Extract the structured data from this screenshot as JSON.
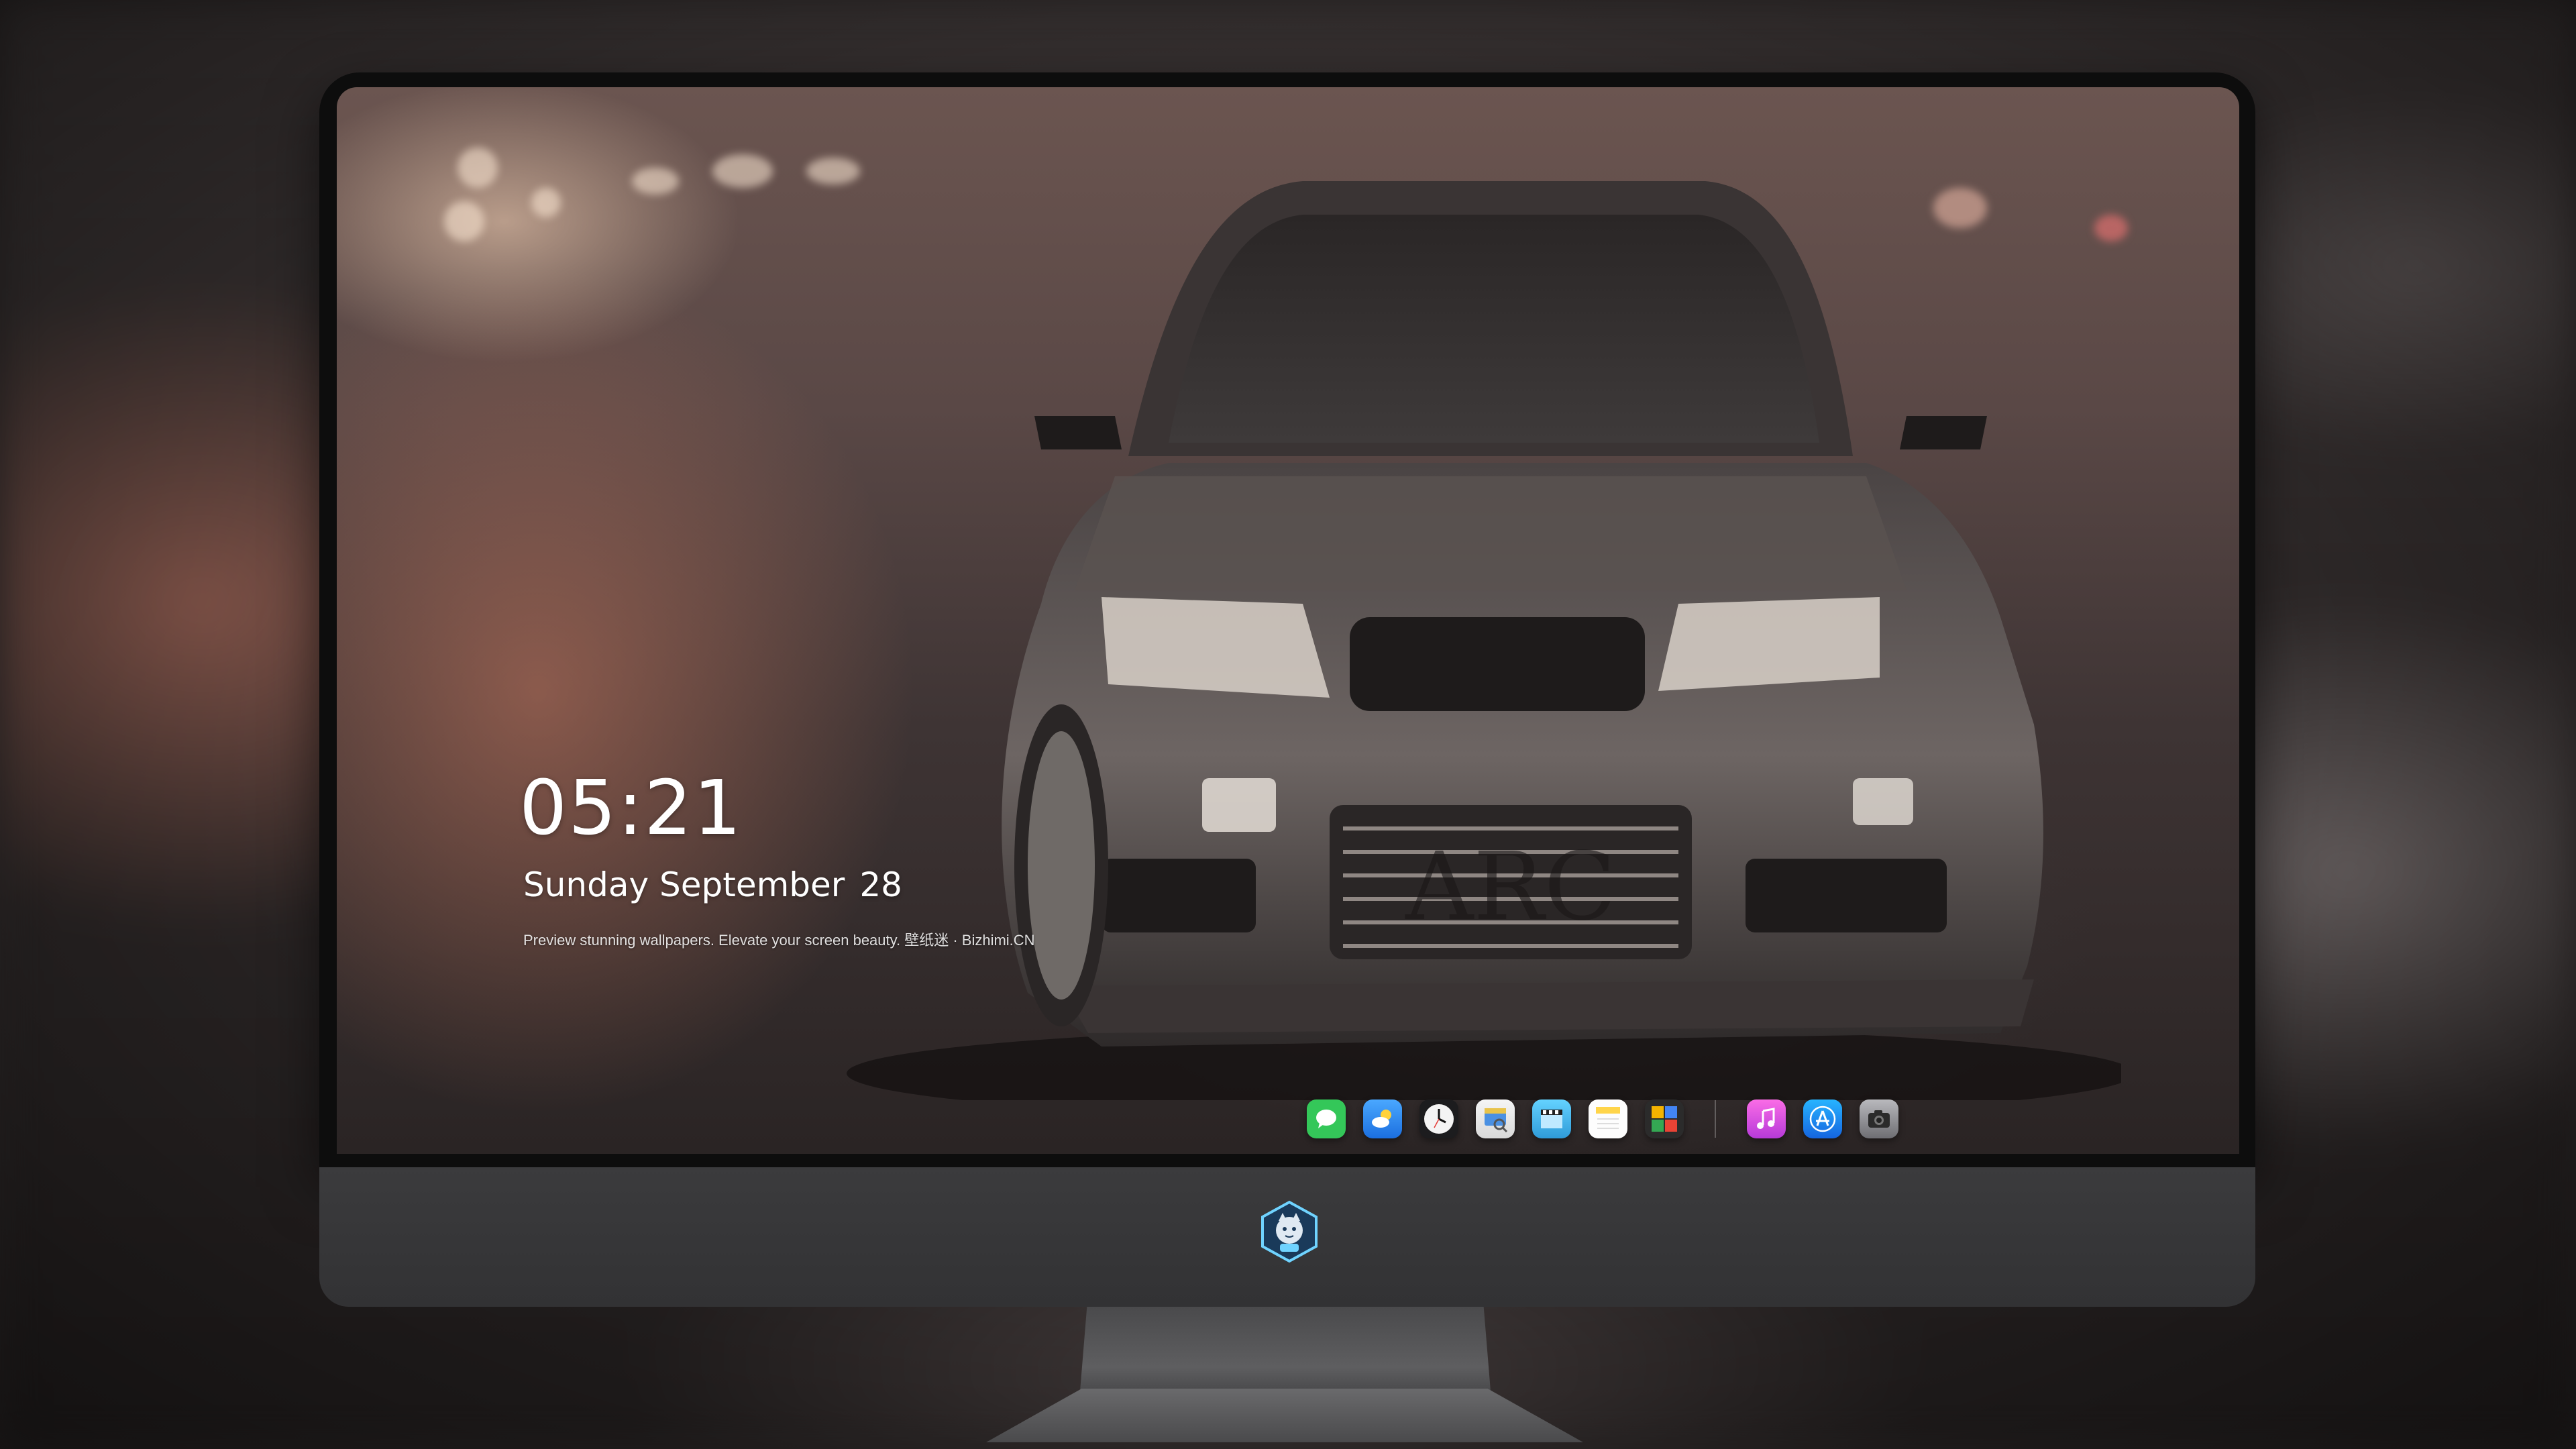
{
  "lockscreen": {
    "time": "05:21",
    "weekday_month": "Sunday September",
    "day": "28",
    "tagline": "Preview stunning wallpapers. Elevate your screen beauty. 壁纸迷 · Bizhimi.CN"
  },
  "wallpaper": {
    "plate_text": "ARC"
  },
  "dock": {
    "apps": [
      {
        "name": "messages-icon",
        "color": "#34c759"
      },
      {
        "name": "weather-icon",
        "color": "#2f8df5"
      },
      {
        "name": "clock-icon",
        "color": "#f2f2f2"
      },
      {
        "name": "preview-icon",
        "color": "#e8c34a"
      },
      {
        "name": "clips-icon",
        "color": "#5ac8fa"
      },
      {
        "name": "notes-icon",
        "color": "#ffd54a"
      },
      {
        "name": "photo-booth-icon",
        "color": "#4caf50"
      },
      {
        "name": "music-icon",
        "color": "#f25bd8"
      },
      {
        "name": "app-store-icon",
        "color": "#1e88f5"
      },
      {
        "name": "camera-icon",
        "color": "#8e8e93"
      }
    ]
  },
  "colors": {
    "bezel": "#0d0d0d",
    "chin": "#3b3b3d",
    "text": "#ffffff"
  }
}
